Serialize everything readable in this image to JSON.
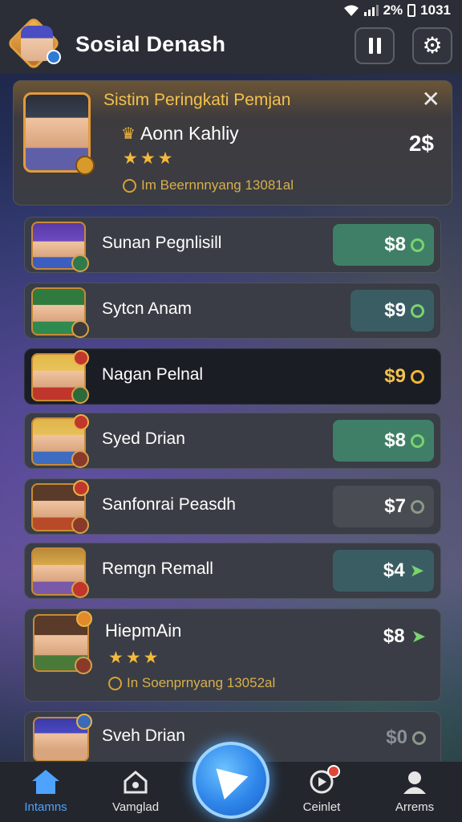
{
  "status_bar": {
    "battery": "2%",
    "time": "1031"
  },
  "header": {
    "title": "Sosial Denash"
  },
  "top_card": {
    "title": "Sistim Peringkati Pemjan",
    "player_name": "Aonn Kahliy",
    "stars": "★★★",
    "subtitle": "Im Beernnnyang 13081al",
    "score": "2$"
  },
  "rows": [
    {
      "name": "Sunan Pegnlisill",
      "price": "$8",
      "indicator": "ring",
      "style": "green"
    },
    {
      "name": "Sytcn Anam",
      "price": "$9",
      "indicator": "ring",
      "style": "teal"
    },
    {
      "name": "Nagan Pelnal",
      "price": "$9",
      "indicator": "gold-ring",
      "style": "dark"
    },
    {
      "name": "Syed Drian",
      "price": "$8",
      "indicator": "ring",
      "style": "green"
    },
    {
      "name": "Sanfonrai Peasdh",
      "price": "$7",
      "indicator": "dim-ring",
      "style": "gray"
    },
    {
      "name": "Remgn Remall",
      "price": "$4",
      "indicator": "arrow",
      "style": "teal"
    }
  ],
  "expanded_row": {
    "name": "HiepmAin",
    "stars": "★★★",
    "subtitle": "In Soenprnyang 13052al",
    "price": "$8"
  },
  "last_row": {
    "name": "Sveh Drian",
    "price": "$0"
  },
  "nav": {
    "items": [
      {
        "label": "Intamns"
      },
      {
        "label": "Vamglad"
      },
      {
        "label": "Ceinlet"
      },
      {
        "label": "Arrems"
      }
    ]
  },
  "colors": {
    "accent": "#4ea3ff",
    "gold": "#f3b93b",
    "green": "#7ad36f"
  }
}
